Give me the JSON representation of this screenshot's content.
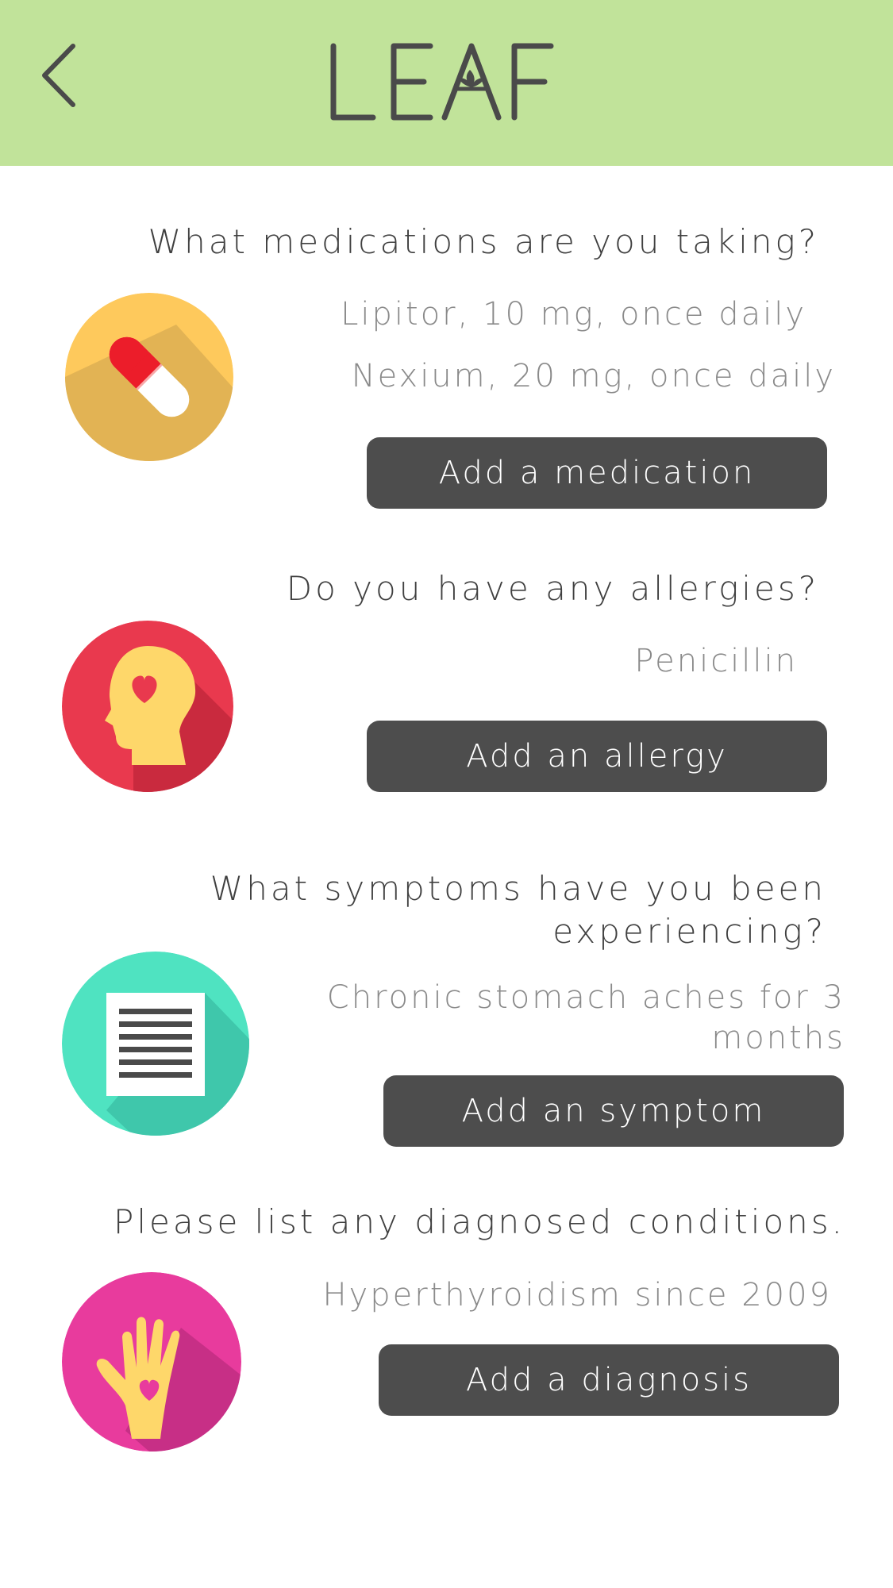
{
  "header": {
    "title": "LEAF",
    "back_icon": "chevron-left-icon",
    "background": "#c1e39a"
  },
  "sections": [
    {
      "question": "What medications are you taking?",
      "answers": [
        "Lipitor, 10 mg, once daily",
        "Nexium, 20 mg, once daily"
      ],
      "button_label": "Add a medication",
      "icon": "pill-icon",
      "icon_color": "#fec95c"
    },
    {
      "question": "Do you have any allergies?",
      "answers": [
        "Penicillin"
      ],
      "button_label": "Add an allergy",
      "icon": "head-heart-icon",
      "icon_color": "#e9394e"
    },
    {
      "question_lines": [
        "What symptoms have you been",
        "experiencing?"
      ],
      "answer_lines": [
        "Chronic stomach aches for 3",
        "months"
      ],
      "button_label": "Add an symptom",
      "icon": "document-icon",
      "icon_color": "#4fe3c1"
    },
    {
      "question": "Please list any diagnosed conditions.",
      "answers": [
        "Hyperthyroidism since 2009"
      ],
      "button_label": "Add a diagnosis",
      "icon": "hand-heart-icon",
      "icon_color": "#e83b9d"
    }
  ],
  "colors": {
    "button_bg": "#4d4d4d",
    "question_text": "#404040",
    "answer_text": "#8a8a8a"
  }
}
